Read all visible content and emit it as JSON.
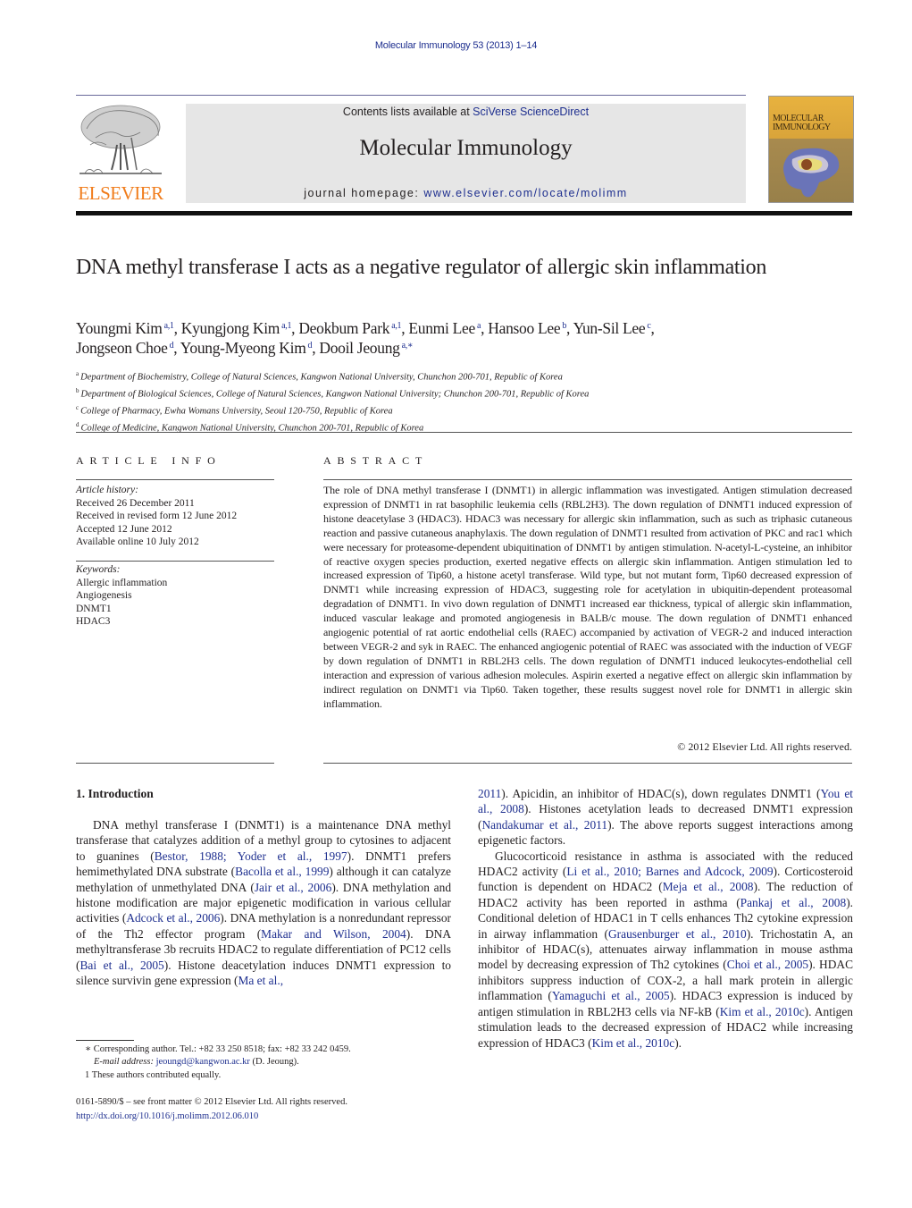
{
  "header": {
    "journal_ref": "Molecular Immunology 53 (2013) 1–14",
    "contents_prefix": "Contents lists available at ",
    "contents_link": "SciVerse ScienceDirect",
    "journal_name": "Molecular Immunology",
    "homepage_prefix": "journal homepage: ",
    "homepage_link": "www.elsevier.com/locate/molimm",
    "publisher_logo_text": "ELSEVIER",
    "cover_title_line1": "MOLECULAR",
    "cover_title_line2": "IMMUNOLOGY",
    "colors": {
      "link": "#1e2f8f",
      "elsevier_orange": "#f07c1b",
      "masthead_bg": "#e6e6e6"
    }
  },
  "article": {
    "title": "DNA methyl transferase I acts as a negative regulator of allergic skin inflammation",
    "authors": [
      {
        "name": "Youngmi Kim",
        "sup": "a,1",
        "sep": ", "
      },
      {
        "name": "Kyungjong Kim",
        "sup": "a,1",
        "sep": ", "
      },
      {
        "name": "Deokbum Park",
        "sup": "a,1",
        "sep": ", "
      },
      {
        "name": "Eunmi Lee",
        "sup": "a",
        "sep": ", "
      },
      {
        "name": "Hansoo Lee",
        "sup": "b",
        "sep": ", "
      },
      {
        "name": "Yun-Sil Lee",
        "sup": "c",
        "sep": ","
      },
      {
        "name": "Jongseon Choe",
        "sup": "d",
        "sep": ", "
      },
      {
        "name": "Young-Myeong Kim",
        "sup": "d",
        "sep": ", "
      },
      {
        "name": "Dooil Jeoung",
        "sup": "a,∗",
        "sep": ""
      }
    ],
    "affiliations": [
      {
        "key": "a",
        "text": "Department of Biochemistry, College of Natural Sciences, Kangwon National University, Chunchon 200-701, Republic of Korea"
      },
      {
        "key": "b",
        "text": "Department of Biological Sciences, College of Natural Sciences, Kangwon National University; Chunchon 200-701, Republic of Korea"
      },
      {
        "key": "c",
        "text": "College of Pharmacy, Ewha Womans University, Seoul 120-750, Republic of Korea"
      },
      {
        "key": "d",
        "text": "College of Medicine, Kangwon National University, Chunchon 200-701, Republic of Korea"
      }
    ]
  },
  "article_info": {
    "heading": "ARTICLE INFO",
    "history_label": "Article history:",
    "history": [
      "Received 26 December 2011",
      "Received in revised form 12 June 2012",
      "Accepted 12 June 2012",
      "Available online 10 July 2012"
    ],
    "keywords_label": "Keywords:",
    "keywords": [
      "Allergic inflammation",
      "Angiogenesis",
      "DNMT1",
      "HDAC3"
    ]
  },
  "abstract": {
    "heading": "ABSTRACT",
    "text": "The role of DNA methyl transferase I (DNMT1) in allergic inflammation was investigated. Antigen stimulation decreased expression of DNMT1 in rat basophilic leukemia cells (RBL2H3). The down regulation of DNMT1 induced expression of histone deacetylase 3 (HDAC3). HDAC3 was necessary for allergic skin inflammation, such as such as triphasic cutaneous reaction and passive cutaneous anaphylaxis. The down regulation of DNMT1 resulted from activation of PKC and rac1 which were necessary for proteasome-dependent ubiquitination of DNMT1 by antigen stimulation. N-acetyl-L-cysteine, an inhibitor of reactive oxygen species production, exerted negative effects on allergic skin inflammation. Antigen stimulation led to increased expression of Tip60, a histone acetyl transferase. Wild type, but not mutant form, Tip60 decreased expression of DNMT1 while increasing expression of HDAC3, suggesting role for acetylation in ubiquitin-dependent proteasomal degradation of DNMT1. In vivo down regulation of DNMT1 increased ear thickness, typical of allergic skin inflammation, induced vascular leakage and promoted angiogenesis in BALB/c mouse. The down regulation of DNMT1 enhanced angiogenic potential of rat aortic endothelial cells (RAEC) accompanied by activation of VEGR-2 and induced interaction between VEGR-2 and syk in RAEC. The enhanced angiogenic potential of RAEC was associated with the induction of VEGF by down regulation of DNMT1 in RBL2H3 cells. The down regulation of DNMT1 induced leukocytes-endothelial cell interaction and expression of various adhesion molecules. Aspirin exerted a negative effect on allergic skin inflammation by indirect regulation on DNMT1 via Tip60. Taken together, these results suggest novel role for DNMT1 in allergic skin inflammation.",
    "copyright": "© 2012 Elsevier Ltd. All rights reserved."
  },
  "introduction": {
    "heading": "1.  Introduction",
    "left_column": [
      {
        "t": "DNA methyl transferase I (DNMT1) is a maintenance DNA methyl transferase that catalyzes addition of a methyl group to cytosines to adjacent to guanines ("
      },
      {
        "link": "Bestor, 1988; Yoder et al., 1997"
      },
      {
        "t": "). DNMT1 prefers hemimethylated DNA substrate ("
      },
      {
        "link": "Bacolla et al., 1999"
      },
      {
        "t": ") although it can catalyze methylation of unmethylated DNA ("
      },
      {
        "link": "Jair et al., 2006"
      },
      {
        "t": "). DNA methylation and histone modification are major epigenetic modification in various cellular activities ("
      },
      {
        "link": "Adcock et al., 2006"
      },
      {
        "t": "). DNA methylation is a nonredundant repressor of the Th2 effector program ("
      },
      {
        "link": "Makar and Wilson, 2004"
      },
      {
        "t": "). DNA methyltransferase 3b recruits HDAC2 to regulate differentiation of PC12 cells ("
      },
      {
        "link": "Bai et al., 2005"
      },
      {
        "t": "). Histone deacetylation induces DNMT1 expression to silence survivin gene expression ("
      },
      {
        "link": "Ma et al.,"
      }
    ],
    "right_column_p1": [
      {
        "link": "2011"
      },
      {
        "t": "). Apicidin, an inhibitor of HDAC(s), down regulates DNMT1 ("
      },
      {
        "link": "You et al., 2008"
      },
      {
        "t": "). Histones acetylation leads to decreased DNMT1 expression ("
      },
      {
        "link": "Nandakumar et al., 2011"
      },
      {
        "t": "). The above reports suggest interactions among epigenetic factors."
      }
    ],
    "right_column_p2": [
      {
        "t": "Glucocorticoid resistance in asthma is associated with the reduced HDAC2 activity ("
      },
      {
        "link": "Li et al., 2010; Barnes and Adcock, 2009"
      },
      {
        "t": "). Corticosteroid function is dependent on HDAC2 ("
      },
      {
        "link": "Meja et al., 2008"
      },
      {
        "t": "). The reduction of HDAC2 activity has been reported in asthma ("
      },
      {
        "link": "Pankaj et al., 2008"
      },
      {
        "t": "). Conditional deletion of HDAC1 in T cells enhances Th2 cytokine expression in airway inflammation ("
      },
      {
        "link": "Grausenburger et al., 2010"
      },
      {
        "t": "). Trichostatin A, an inhibitor of HDAC(s), attenuates airway inflammation in mouse asthma model by decreasing expression of Th2 cytokines ("
      },
      {
        "link": "Choi et al., 2005"
      },
      {
        "t": "). HDAC inhibitors suppress induction of COX-2, a hall mark protein in allergic inflammation ("
      },
      {
        "link": "Yamaguchi et al., 2005"
      },
      {
        "t": "). HDAC3 expression is induced by antigen stimulation in RBL2H3 cells via NF-kB ("
      },
      {
        "link": "Kim et al., 2010c"
      },
      {
        "t": "). Antigen stimulation leads to the decreased expression of HDAC2 while increasing expression of HDAC3 ("
      },
      {
        "link": "Kim et al., 2010c"
      },
      {
        "t": ")."
      }
    ]
  },
  "footnotes": {
    "corresponding_mark": "∗",
    "corresponding": "Corresponding author. Tel.: +82 33 250 8518; fax: +82 33 242 0459.",
    "email_label": "E-mail address: ",
    "email": "jeoungd@kangwon.ac.kr",
    "email_suffix": " (D. Jeoung).",
    "equal_mark": "1",
    "equal": "These authors contributed equally.",
    "front_matter": "0161-5890/$ – see front matter © 2012 Elsevier Ltd. All rights reserved.",
    "doi": "http://dx.doi.org/10.1016/j.molimm.2012.06.010"
  }
}
